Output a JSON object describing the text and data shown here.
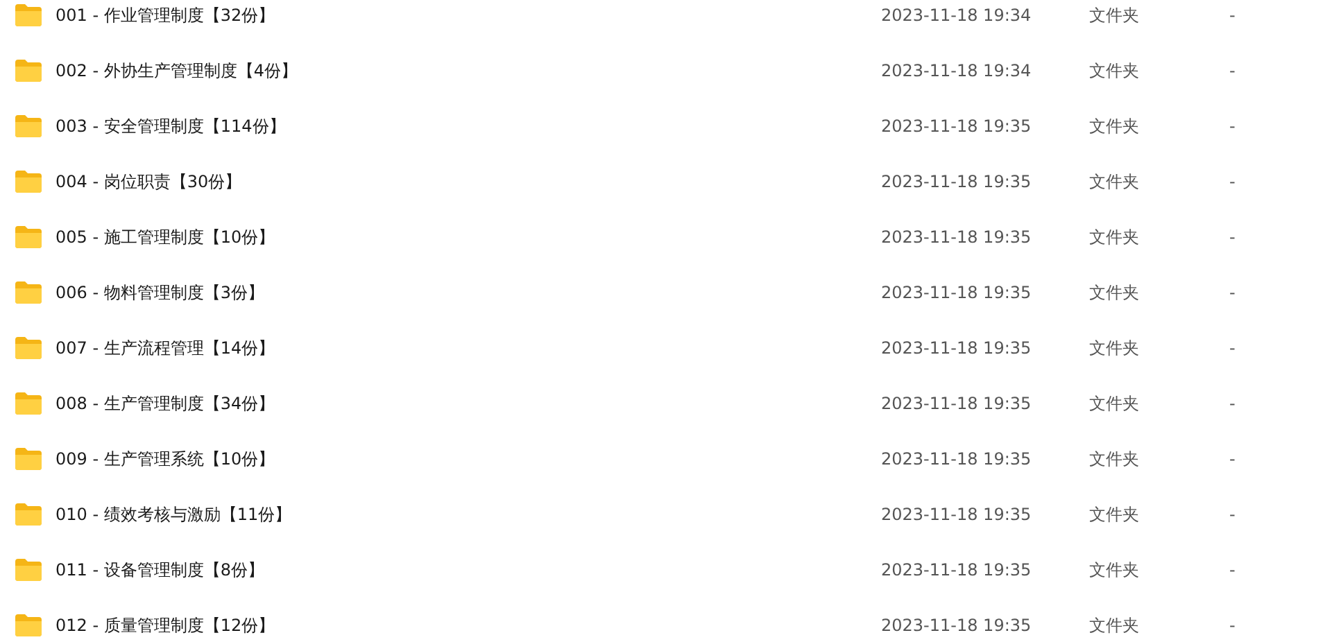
{
  "files": [
    {
      "name": "001 - 作业管理制度【32份】",
      "modified": "2023-11-18 19:34",
      "type": "文件夹",
      "size": "-"
    },
    {
      "name": "002 - 外协生产管理制度【4份】",
      "modified": "2023-11-18 19:34",
      "type": "文件夹",
      "size": "-"
    },
    {
      "name": "003 - 安全管理制度【114份】",
      "modified": "2023-11-18 19:35",
      "type": "文件夹",
      "size": "-"
    },
    {
      "name": "004 - 岗位职责【30份】",
      "modified": "2023-11-18 19:35",
      "type": "文件夹",
      "size": "-"
    },
    {
      "name": "005 - 施工管理制度【10份】",
      "modified": "2023-11-18 19:35",
      "type": "文件夹",
      "size": "-"
    },
    {
      "name": "006 - 物料管理制度【3份】",
      "modified": "2023-11-18 19:35",
      "type": "文件夹",
      "size": "-"
    },
    {
      "name": "007 - 生产流程管理【14份】",
      "modified": "2023-11-18 19:35",
      "type": "文件夹",
      "size": "-"
    },
    {
      "name": "008 - 生产管理制度【34份】",
      "modified": "2023-11-18 19:35",
      "type": "文件夹",
      "size": "-"
    },
    {
      "name": "009 - 生产管理系统【10份】",
      "modified": "2023-11-18 19:35",
      "type": "文件夹",
      "size": "-"
    },
    {
      "name": "010 - 绩效考核与激励【11份】",
      "modified": "2023-11-18 19:35",
      "type": "文件夹",
      "size": "-"
    },
    {
      "name": "011 - 设备管理制度【8份】",
      "modified": "2023-11-18 19:35",
      "type": "文件夹",
      "size": "-"
    },
    {
      "name": "012 - 质量管理制度【12份】",
      "modified": "2023-11-18 19:35",
      "type": "文件夹",
      "size": "-"
    }
  ]
}
